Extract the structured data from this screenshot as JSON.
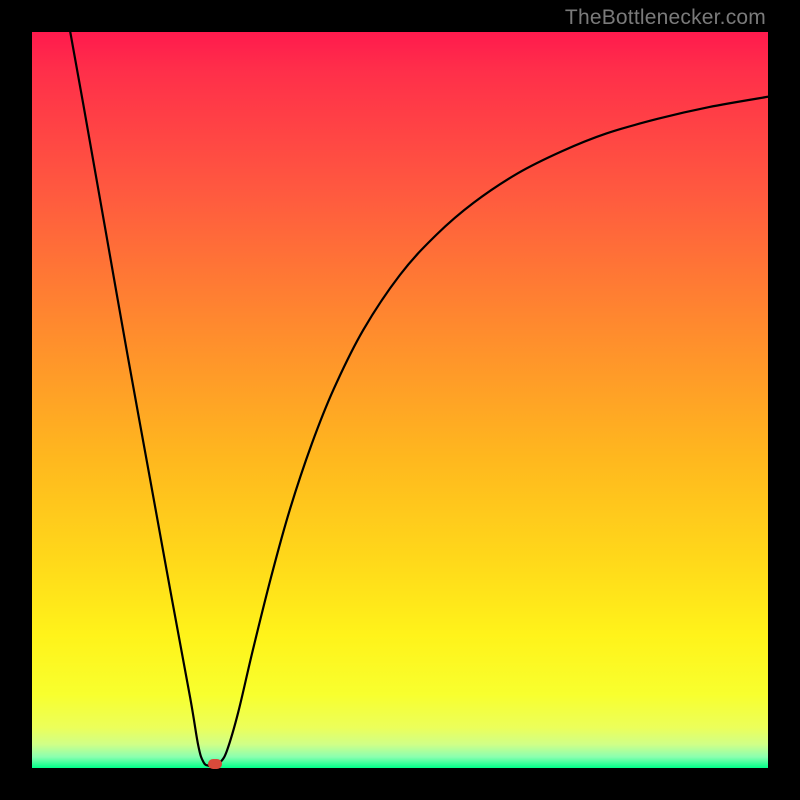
{
  "watermark": {
    "text": "TheBottlenecker.com"
  },
  "chart_data": {
    "type": "line",
    "title": "",
    "xlabel": "",
    "ylabel": "",
    "xlim": [
      0,
      100
    ],
    "ylim": [
      0,
      100
    ],
    "gradient_stops": [
      {
        "pos": 0,
        "color": "#ff1a4d"
      },
      {
        "pos": 0.05,
        "color": "#ff2e4a"
      },
      {
        "pos": 0.22,
        "color": "#ff5a3f"
      },
      {
        "pos": 0.4,
        "color": "#ff8a2e"
      },
      {
        "pos": 0.58,
        "color": "#ffb81e"
      },
      {
        "pos": 0.72,
        "color": "#ffd91a"
      },
      {
        "pos": 0.82,
        "color": "#fff31a"
      },
      {
        "pos": 0.9,
        "color": "#f8ff2e"
      },
      {
        "pos": 0.945,
        "color": "#ecff5a"
      },
      {
        "pos": 0.968,
        "color": "#d0ff88"
      },
      {
        "pos": 0.985,
        "color": "#8affb0"
      },
      {
        "pos": 1.0,
        "color": "#00ff88"
      }
    ],
    "series": [
      {
        "name": "bottleneck-curve",
        "color": "#000000",
        "width": 2.2,
        "points": [
          {
            "x": 5.2,
            "y": 100.0
          },
          {
            "x": 7.0,
            "y": 90.0
          },
          {
            "x": 10.0,
            "y": 73.0
          },
          {
            "x": 13.0,
            "y": 56.0
          },
          {
            "x": 16.0,
            "y": 39.5
          },
          {
            "x": 19.0,
            "y": 23.0
          },
          {
            "x": 21.5,
            "y": 9.5
          },
          {
            "x": 22.6,
            "y": 3.0
          },
          {
            "x": 23.3,
            "y": 0.8
          },
          {
            "x": 24.0,
            "y": 0.3
          },
          {
            "x": 24.8,
            "y": 0.3
          },
          {
            "x": 25.6,
            "y": 0.8
          },
          {
            "x": 26.5,
            "y": 2.4
          },
          {
            "x": 28.0,
            "y": 7.5
          },
          {
            "x": 30.0,
            "y": 16.0
          },
          {
            "x": 32.5,
            "y": 26.0
          },
          {
            "x": 35.0,
            "y": 35.0
          },
          {
            "x": 38.0,
            "y": 44.0
          },
          {
            "x": 41.0,
            "y": 51.5
          },
          {
            "x": 45.0,
            "y": 59.5
          },
          {
            "x": 50.0,
            "y": 67.0
          },
          {
            "x": 55.0,
            "y": 72.5
          },
          {
            "x": 60.0,
            "y": 76.8
          },
          {
            "x": 66.0,
            "y": 80.8
          },
          {
            "x": 72.0,
            "y": 83.8
          },
          {
            "x": 78.0,
            "y": 86.2
          },
          {
            "x": 85.0,
            "y": 88.2
          },
          {
            "x": 92.0,
            "y": 89.8
          },
          {
            "x": 100.0,
            "y": 91.2
          }
        ]
      }
    ],
    "marker": {
      "x": 24.8,
      "y": 0.6,
      "color": "#d94a3b"
    }
  }
}
